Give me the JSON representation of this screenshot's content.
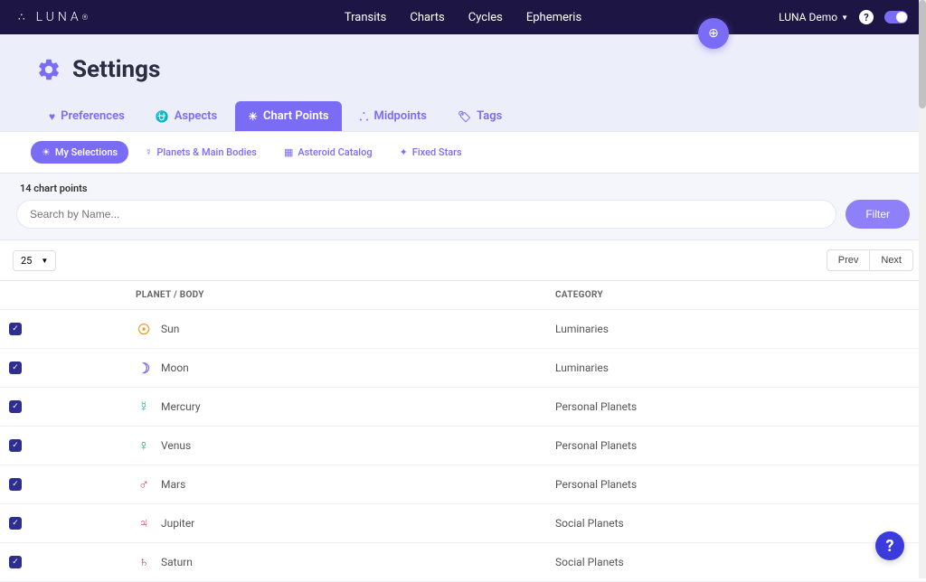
{
  "brand": {
    "name": "LUNA",
    "reg": "®"
  },
  "nav": {
    "items": [
      "Transits",
      "Charts",
      "Cycles",
      "Ephemeris"
    ]
  },
  "user": {
    "label": "LUNA Demo"
  },
  "page": {
    "title": "Settings"
  },
  "tabs_main": [
    {
      "label": "Preferences",
      "icon": "♥"
    },
    {
      "label": "Aspects",
      "icon": "⛎"
    },
    {
      "label": "Chart Points",
      "icon": "☀"
    },
    {
      "label": "Midpoints",
      "icon": "⸫"
    },
    {
      "label": "Tags",
      "icon": "🏷"
    }
  ],
  "tabs_sub": [
    {
      "label": "My Selections",
      "icon": "☀"
    },
    {
      "label": "Planets & Main Bodies",
      "icon": "☿"
    },
    {
      "label": "Asteroid Catalog",
      "icon": "▦"
    },
    {
      "label": "Fixed Stars",
      "icon": "✦"
    }
  ],
  "count_label": "14 chart points",
  "search": {
    "placeholder": "Search by Name..."
  },
  "filter_btn": "Filter",
  "pagesize": "25",
  "pager": {
    "prev": "Prev",
    "next": "Next"
  },
  "columns": {
    "body": "PLANET / BODY",
    "category": "CATEGORY"
  },
  "rows": [
    {
      "name": "Sun",
      "glyph": "☉",
      "color": "#f0a020",
      "category": "Luminaries"
    },
    {
      "name": "Moon",
      "glyph": "☽",
      "color": "#7b6cf6",
      "category": "Luminaries"
    },
    {
      "name": "Mercury",
      "glyph": "☿",
      "color": "#2aa8a8",
      "category": "Personal Planets"
    },
    {
      "name": "Venus",
      "glyph": "♀",
      "color": "#1aa86a",
      "category": "Personal Planets"
    },
    {
      "name": "Mars",
      "glyph": "♂",
      "color": "#d84060",
      "category": "Personal Planets"
    },
    {
      "name": "Jupiter",
      "glyph": "♃",
      "color": "#d84060",
      "category": "Social Planets"
    },
    {
      "name": "Saturn",
      "glyph": "♄",
      "color": "#b05080",
      "category": "Social Planets"
    }
  ],
  "help_glyph": "?"
}
